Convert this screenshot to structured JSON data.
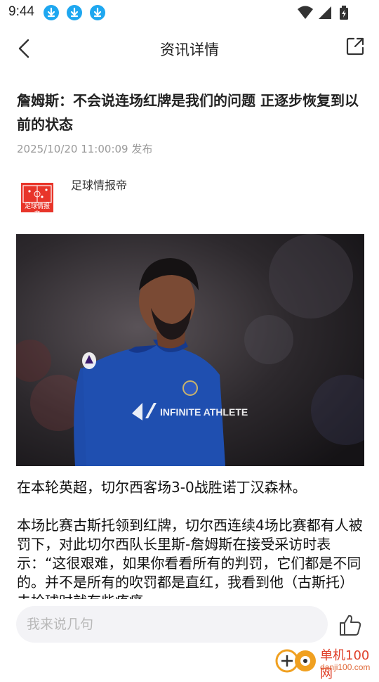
{
  "status_bar": {
    "time": "9:44",
    "notification_icons": [
      "download-icon",
      "download-icon",
      "download-icon"
    ],
    "system_icons": [
      "wifi-icon",
      "signal-icon",
      "battery-icon"
    ]
  },
  "header": {
    "title": "资讯详情",
    "back_icon": "back-icon",
    "share_icon": "share-icon"
  },
  "article": {
    "title": "詹姆斯：不会说连场红牌是我们的问题 正逐步恢复到以前的状态",
    "publish_time": "2025/10/20 11:00:09 发布",
    "author": "足球情报帝",
    "author_logo_text": "足球情报帝",
    "image_jersey_text": "INFINITE ATHLETE",
    "paragraphs": [
      "在本轮英超，切尔西客场3-0战胜诺丁汉森林。",
      "本场比赛古斯托领到红牌，切尔西连续4场比赛都有人被罚下，对此切尔西队长里斯-詹姆斯在接受采访时表示：“这很艰难，如果你看看所有的判罚，它们都是不同的。并不是所有的吹罚都是直红，我看到他（古斯托）去抢球时就有些疼痛"
    ]
  },
  "footer": {
    "comment_placeholder": "我来说几句",
    "like_icon": "thumbs-up-icon"
  },
  "watermark": {
    "name": "单机100网",
    "url": "danji100.com"
  },
  "colors": {
    "accent_blue": "#1ea7f0",
    "logo_red": "#e8352a",
    "watermark_red": "#e0402a",
    "jersey_blue": "#1f4fb0"
  }
}
